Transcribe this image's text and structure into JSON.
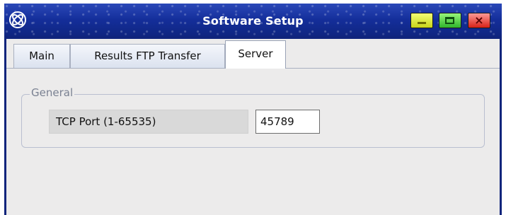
{
  "window": {
    "title": "Software Setup",
    "icon": "orbit-logo-icon"
  },
  "title_buttons": {
    "minimize_icon": "minimize-icon",
    "maximize_icon": "maximize-icon",
    "close_icon": "close-icon",
    "close_glyph": "×"
  },
  "tabs": [
    {
      "label": "Main",
      "selected": false
    },
    {
      "label": "Results FTP Transfer",
      "selected": false
    },
    {
      "label": "Server",
      "selected": true
    }
  ],
  "server": {
    "group_label": "General",
    "port_label": "TCP Port (1-65535)",
    "port_value": "45789"
  },
  "colors": {
    "titlebar": "#142e9a",
    "client_bg": "#ecebeb",
    "minimize": "#dde43a",
    "maximize": "#45c33b",
    "close": "#e6362c"
  }
}
